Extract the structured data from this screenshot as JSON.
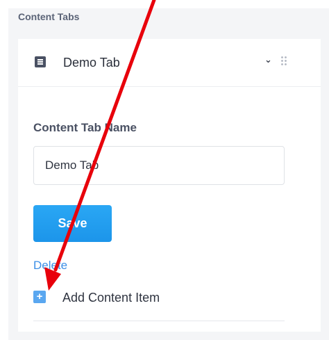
{
  "section": {
    "title": "Content Tabs"
  },
  "tab": {
    "name": "Demo Tab",
    "icon": "list-icon",
    "expand_icon": "chevron-down-icon",
    "drag_icon": "drag-handle-icon"
  },
  "form": {
    "name_label": "Content Tab Name",
    "name_value": "Demo Tab",
    "save_label": "Save",
    "delete_label": "Delete",
    "add_item_label": "Add Content Item",
    "add_icon": "plus-icon"
  },
  "colors": {
    "accent": "#1e9af0",
    "link": "#3c8fe6",
    "annotation_arrow": "#e8000b"
  }
}
